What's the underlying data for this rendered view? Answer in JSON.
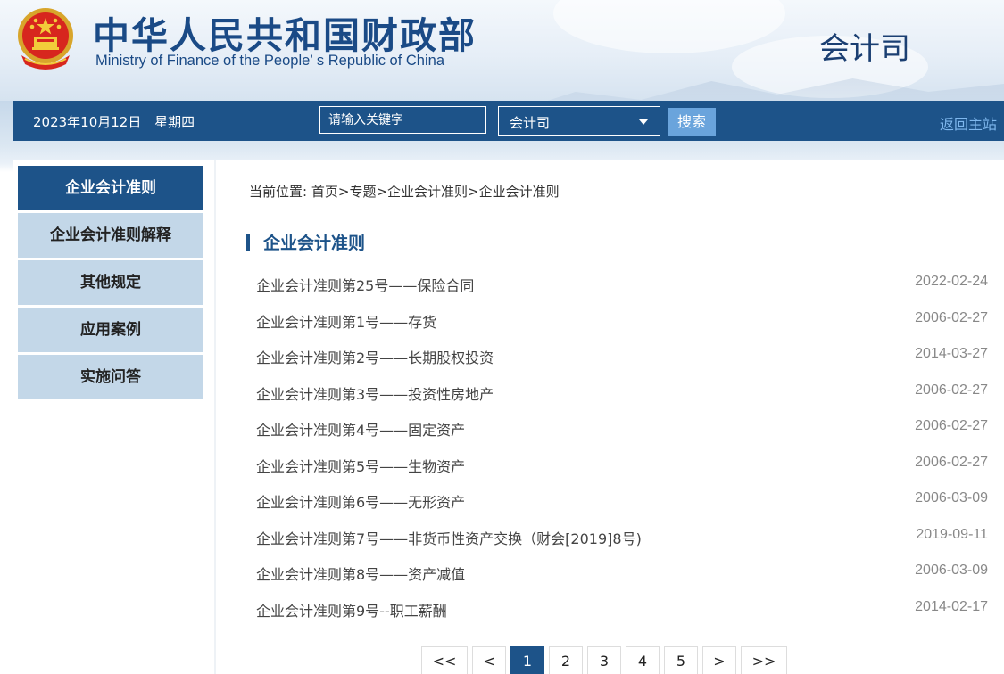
{
  "header": {
    "title_cn": "中华人民共和国财政部",
    "title_en": "Ministry of Finance of the People’ s Republic of China",
    "department": "会计司",
    "emblem_icon": "national-emblem-icon"
  },
  "navbar": {
    "date": "2023年10月12日",
    "weekday": "星期四",
    "search_placeholder": "请输入关键字",
    "scope_select": "会计司",
    "search_button": "搜索",
    "home_link": "返回主站"
  },
  "sidebar": {
    "items": [
      {
        "label": "企业会计准则",
        "active": true
      },
      {
        "label": "企业会计准则解释",
        "active": false
      },
      {
        "label": "其他规定",
        "active": false
      },
      {
        "label": "应用案例",
        "active": false
      },
      {
        "label": "实施问答",
        "active": false
      }
    ]
  },
  "breadcrumb": {
    "prefix": "当前位置:",
    "items": [
      "首页",
      "专题",
      "企业会计准则",
      "企业会计准则"
    ],
    "separator": ">"
  },
  "section": {
    "title": "企业会计准则"
  },
  "articles": [
    {
      "title": "企业会计准则第25号——保险合同",
      "date": "2022-02-24"
    },
    {
      "title": "企业会计准则第1号——存货",
      "date": "2006-02-27"
    },
    {
      "title": "企业会计准则第2号——长期股权投资",
      "date": "2014-03-27"
    },
    {
      "title": "企业会计准则第3号——投资性房地产",
      "date": "2006-02-27"
    },
    {
      "title": "企业会计准则第4号——固定资产",
      "date": "2006-02-27"
    },
    {
      "title": "企业会计准则第5号——生物资产",
      "date": "2006-02-27"
    },
    {
      "title": "企业会计准则第6号——无形资产",
      "date": "2006-03-09"
    },
    {
      "title": "企业会计准则第7号——非货币性资产交换（财会[2019]8号)",
      "date": "2019-09-11"
    },
    {
      "title": "企业会计准则第8号——资产减值",
      "date": "2006-03-09"
    },
    {
      "title": "企业会计准则第9号--职工薪酬",
      "date": "2014-02-17"
    }
  ],
  "pagination": {
    "first": "<<",
    "prev": "<",
    "pages": [
      "1",
      "2",
      "3",
      "4",
      "5"
    ],
    "current": "1",
    "next": ">",
    "last": ">>"
  },
  "colors": {
    "primary": "#1d5389",
    "sidebar_inactive": "#c3d7e8",
    "search_button": "#6aa4dc",
    "home_link": "#7fb8ee"
  }
}
